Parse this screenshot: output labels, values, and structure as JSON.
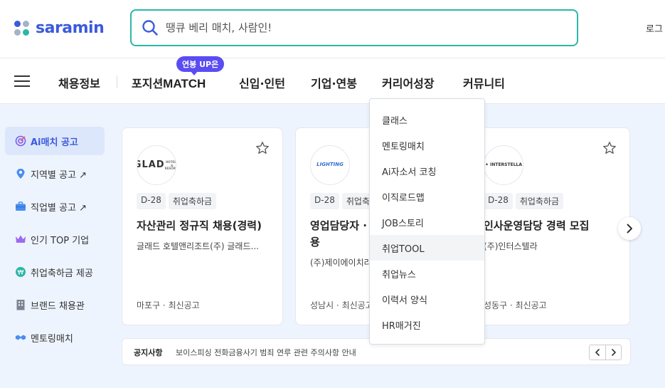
{
  "header": {
    "logo_text": "saramin",
    "search_placeholder": "땡큐 베리 매치, 사람인!",
    "login_label": "로그"
  },
  "nav": {
    "items": [
      "채용정보",
      "포지션",
      "신입·인턴",
      "기업·연봉",
      "커리어성장",
      "커뮤니티"
    ],
    "match_label": "MATCH",
    "badge": "연봉 UP은"
  },
  "sidebar": {
    "items": [
      {
        "label": "Ai매치 공고",
        "icon": "target-icon"
      },
      {
        "label": "지역별 공고 ↗",
        "icon": "map-pin-icon"
      },
      {
        "label": "직업별 공고 ↗",
        "icon": "briefcase-icon"
      },
      {
        "label": "인기 TOP 기업",
        "icon": "crown-icon"
      },
      {
        "label": "취업축하금 제공",
        "icon": "won-coin-icon"
      },
      {
        "label": "브랜드 채용관",
        "icon": "building-icon"
      },
      {
        "label": "멘토링매치",
        "icon": "handshake-icon"
      }
    ]
  },
  "cards": [
    {
      "logo": "GLAD",
      "logo_sub": "HOTELS & RESORTS",
      "dday": "D-28",
      "tag": "취업축하금",
      "title": "자산관리 정규직 채용(경력)",
      "company": "글래드 호텔앤리조트(주) 글래드...",
      "location": "마포구 · 최신공고"
    },
    {
      "logo": "LIGHTING",
      "logo_sub": "",
      "dday": "D-28",
      "tag": "취업축",
      "title": "영업담당자 ·\n용",
      "company": "(주)제이에이치라",
      "location": "성남시 · 최신공고"
    },
    {
      "logo": "✦ INTERSTELLA",
      "logo_sub": "",
      "dday": "D-28",
      "tag": "취업축하금",
      "title": "인사운영담당 경력 모집",
      "company": "(주)인터스텔라",
      "location": "성동구 · 최신공고"
    }
  ],
  "notice": {
    "label": "공지사항",
    "text": "보이스피싱 전화금융사기 범죄 연루 관련 주의사항 안내"
  },
  "dropdown": {
    "items": [
      "클래스",
      "멘토링매치",
      "Ai자소서 코칭",
      "이직로드맵",
      "JOB스토리",
      "취업TOOL",
      "취업뉴스",
      "이력서 양식",
      "HR매거진"
    ]
  },
  "colors": {
    "brand": "#3b5bdb",
    "search_border": "#2bb7a7",
    "badge": "#5b4cf2",
    "background": "#eef4fd"
  }
}
